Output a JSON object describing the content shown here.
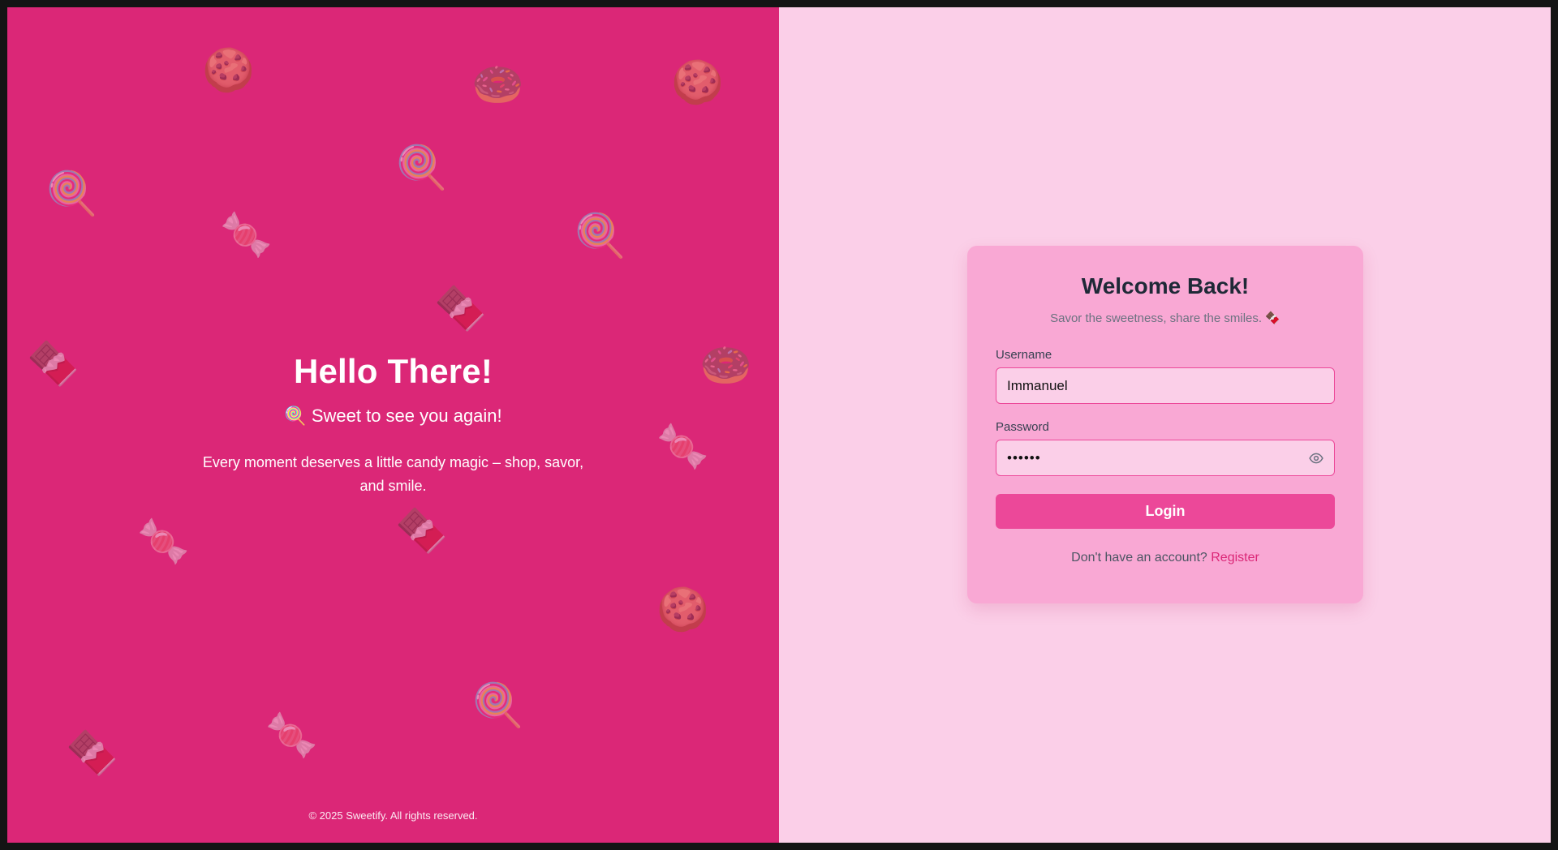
{
  "hero": {
    "title": "Hello There!",
    "tagline": "🍭 Sweet to see you again!",
    "description": "Every moment deserves a little candy magic – shop, savor, and smile.",
    "copyright": "© 2025 Sweetify. All rights reserved."
  },
  "decorations": [
    "🍪",
    "🍩",
    "🍪",
    "🍭",
    "🍭",
    "🍬",
    "🍭",
    "🍫",
    "🍫",
    "🍩",
    "🍬",
    "🍬",
    "🍫",
    "🍪",
    "🍭",
    "🍬",
    "🍫"
  ],
  "login": {
    "title": "Welcome Back!",
    "subtitle": "Savor the sweetness, share the smiles. 🍫",
    "username_label": "Username",
    "username_value": "Immanuel",
    "password_label": "Password",
    "password_value": "••••••",
    "submit_label": "Login",
    "register_prompt": "Don't have an account?",
    "register_link": "Register"
  },
  "colors": {
    "left_panel": "#db2777",
    "right_panel": "#fbcfe8",
    "card": "#f9a8d4",
    "button": "#ec4899"
  }
}
